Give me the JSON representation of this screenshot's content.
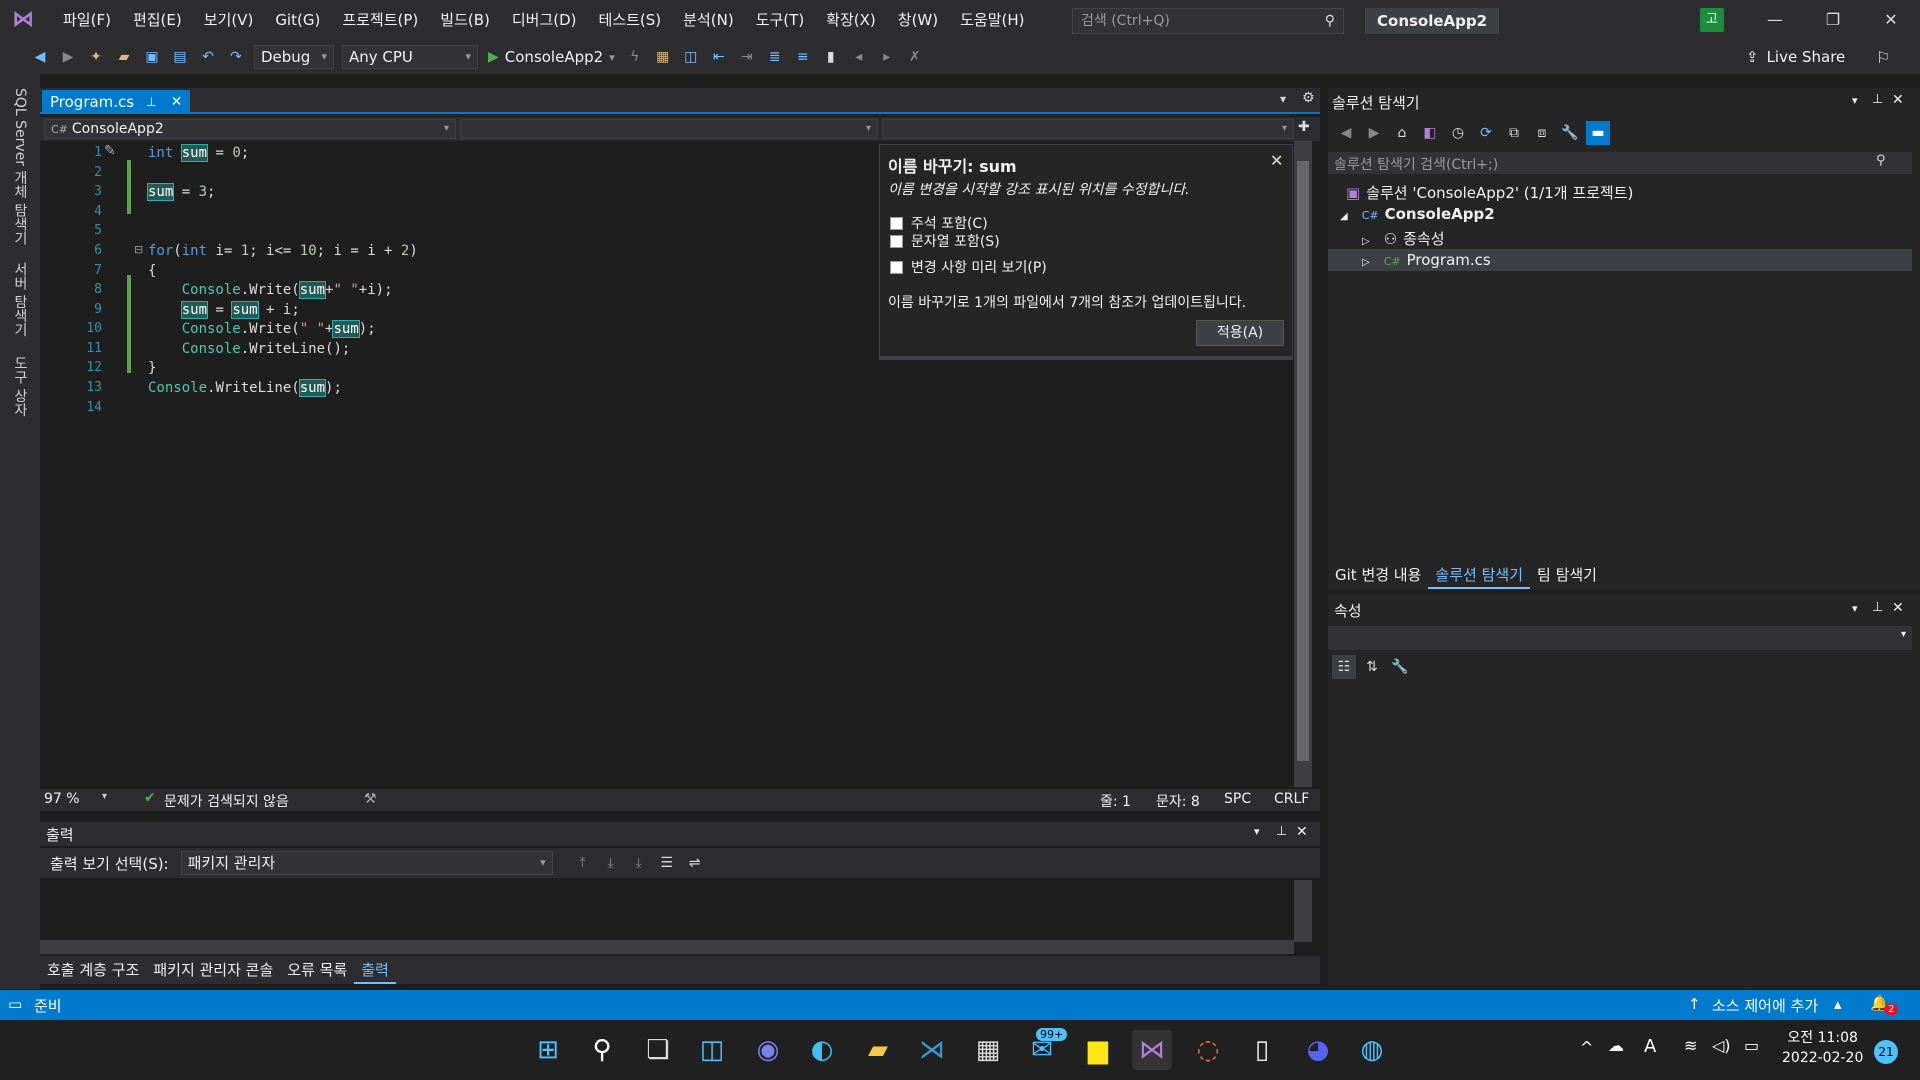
{
  "menu": [
    "파일(F)",
    "편집(E)",
    "보기(V)",
    "Git(G)",
    "프로젝트(P)",
    "빌드(B)",
    "디버그(D)",
    "테스트(S)",
    "분석(N)",
    "도구(T)",
    "확장(X)",
    "창(W)",
    "도움말(H)"
  ],
  "search_placeholder": "검색 (Ctrl+Q)",
  "window_title": "ConsoleApp2",
  "user_badge": "고",
  "toolbar": {
    "config": "Debug",
    "platform": "Any CPU",
    "run_target": "ConsoleApp2",
    "live_share": "Live Share"
  },
  "left_strip_tabs": [
    "SQL Server 개체 탐색기",
    "서버 탐색기",
    "도구 상자"
  ],
  "editor": {
    "tab_label": "Program.cs",
    "nav_project": "ConsoleApp2",
    "line_numbers": [
      "1",
      "2",
      "3",
      "4",
      "5",
      "6",
      "7",
      "8",
      "9",
      "10",
      "11",
      "12",
      "13",
      "14"
    ],
    "zoom": "97 %",
    "issues": "문제가 검색되지 않음",
    "line": "줄: 1",
    "char": "문자: 8",
    "spc": "SPC",
    "eol": "CRLF"
  },
  "rename": {
    "title": "이름 바꾸기: sum",
    "description": "이름 변경을 시작할 강조 표시된 위치를 수정합니다.",
    "option_comments": "주석 포함(C)",
    "option_strings": "문자열 포함(S)",
    "option_preview": "변경 사항 미리 보기(P)",
    "info": "이름 바꾸기로 1개의 파일에서 7개의 참조가 업데이트됩니다.",
    "apply": "적용(A)"
  },
  "output": {
    "title": "출력",
    "source_label": "출력 보기 선택(S):",
    "source_value": "패키지 관리자",
    "bottom_tabs": [
      "호출 계층 구조",
      "패키지 관리자 콘솔",
      "오류 목록",
      "출력"
    ]
  },
  "solution_explorer": {
    "title": "솔루션 탐색기",
    "search_placeholder": "솔루션 탐색기 검색(Ctrl+;)",
    "solution": "솔루션 'ConsoleApp2' (1/1개 프로젝트)",
    "project": "ConsoleApp2",
    "dependencies": "종속성",
    "file": "Program.cs",
    "tabs": [
      "Git 변경 내용",
      "솔루션 탐색기",
      "팀 탐색기"
    ]
  },
  "properties": {
    "title": "속성"
  },
  "statusbar": {
    "ready": "준비",
    "source_control": "소스 제어에 추가",
    "notifications": "2"
  },
  "taskbar": {
    "mail_badge": "99+",
    "time": "오전 11:08",
    "date": "2022-02-20",
    "notif_count": "21",
    "ime": "A"
  }
}
